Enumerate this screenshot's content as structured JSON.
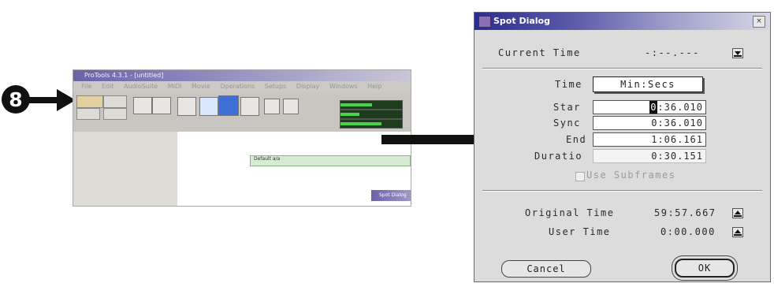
{
  "step": {
    "number": "8"
  },
  "small_screenshot": {
    "title": "ProTools 4.3.1 - [untitled]",
    "menu": [
      "File",
      "Edit",
      "AudioSuite",
      "MIDI",
      "Movie",
      "Operations",
      "Setups",
      "Display",
      "Windows",
      "Help"
    ],
    "clip_label": "Default a/a",
    "mini_dialog_title": "Spot Dialog"
  },
  "dialog": {
    "title": "Spot Dialog",
    "close_label": "×",
    "current_time_label": "Current Time",
    "current_time_value": "-:--.---",
    "time_label": "Time",
    "time_format": "Min:Secs",
    "start_label": "Star",
    "start_value_hl": "0",
    "start_value_rest": ":36.010",
    "sync_label": "Sync",
    "sync_value": "0:36.010",
    "end_label": "End",
    "end_value": "1:06.161",
    "duration_label": "Duratio",
    "duration_value": "0:30.151",
    "use_subframes_label": "Use Subframes",
    "original_time_label": "Original Time",
    "original_time_value": "59:57.667",
    "user_time_label": "User Time",
    "user_time_value": "0:00.000",
    "cancel_label": "Cancel",
    "ok_label": "OK"
  }
}
